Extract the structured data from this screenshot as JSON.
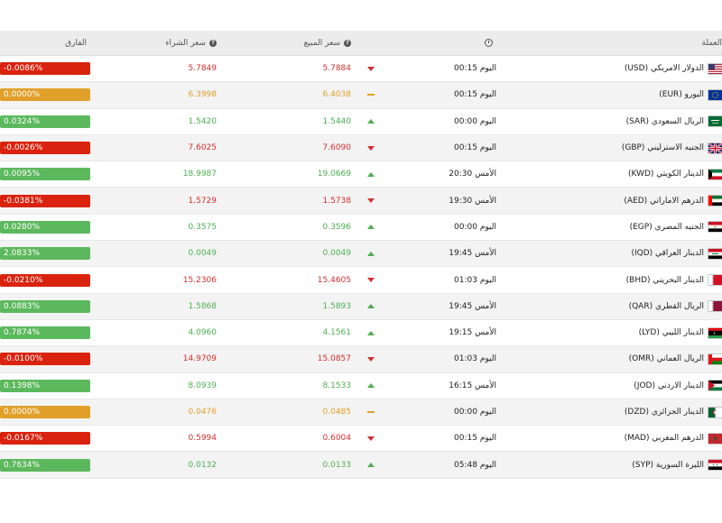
{
  "header": {
    "currency_label": "العملة",
    "sell_label": "سعر المبيع",
    "buy_label": "سعر الشراء",
    "diff_label": "الفارق",
    "time_icon": "clock-icon",
    "info_icon": "info-icon"
  },
  "rows": [
    {
      "name": "الدولار الامريكي (USD)",
      "flag": "us",
      "time": "اليوم 00:15",
      "trend": "down",
      "sell": "5.7884",
      "buy": "5.7849",
      "diff": "-0.0086%"
    },
    {
      "name": "اليورو (EUR)",
      "flag": "eu",
      "time": "اليوم 00:15",
      "trend": "flat",
      "sell": "6.4038",
      "buy": "6.3998",
      "diff": "0.0000%"
    },
    {
      "name": "الريال السعودي (SAR)",
      "flag": "sa",
      "time": "اليوم 00:00",
      "trend": "up",
      "sell": "1.5440",
      "buy": "1.5420",
      "diff": "0.0324%"
    },
    {
      "name": "الجنيه الاسترليني (GBP)",
      "flag": "gb",
      "time": "اليوم 00:15",
      "trend": "down",
      "sell": "7.6090",
      "buy": "7.6025",
      "diff": "-0.0026%"
    },
    {
      "name": "الدينار الكويتي (KWD)",
      "flag": "kw",
      "time": "الأمس 20:30",
      "trend": "up",
      "sell": "19.0669",
      "buy": "18.9987",
      "diff": "0.0095%"
    },
    {
      "name": "الدرهم الاماراتي (AED)",
      "flag": "ae",
      "time": "الأمس 19:30",
      "trend": "down",
      "sell": "1.5738",
      "buy": "1.5729",
      "diff": "-0.0381%"
    },
    {
      "name": "الجنيه المصري (EGP)",
      "flag": "eg",
      "time": "اليوم 00:00",
      "trend": "up",
      "sell": "0.3596",
      "buy": "0.3575",
      "diff": "0.0280%"
    },
    {
      "name": "الدينار العراقي (IQD)",
      "flag": "iq",
      "time": "الأمس 19:45",
      "trend": "up",
      "sell": "0.0049",
      "buy": "0.0049",
      "diff": "2.0833%"
    },
    {
      "name": "الدينار البحريني (BHD)",
      "flag": "bh",
      "time": "اليوم 01:03",
      "trend": "down",
      "sell": "15.4605",
      "buy": "15.2306",
      "diff": "-0.0210%"
    },
    {
      "name": "الريال القطري (QAR)",
      "flag": "qa",
      "time": "الأمس 19:45",
      "trend": "up",
      "sell": "1.5893",
      "buy": "1.5868",
      "diff": "0.0883%"
    },
    {
      "name": "الدينار الليبي (LYD)",
      "flag": "ly",
      "time": "الأمس 19:15",
      "trend": "up",
      "sell": "4.1561",
      "buy": "4.0960",
      "diff": "0.7874%"
    },
    {
      "name": "الريال العماني (OMR)",
      "flag": "om",
      "time": "اليوم 01:03",
      "trend": "down",
      "sell": "15.0857",
      "buy": "14.9709",
      "diff": "-0.0100%"
    },
    {
      "name": "الدينار الاردني (JOD)",
      "flag": "jo",
      "time": "الأمس 16:15",
      "trend": "up",
      "sell": "8.1533",
      "buy": "8.0939",
      "diff": "0.1398%"
    },
    {
      "name": "الدينار الجزائري (DZD)",
      "flag": "dz",
      "time": "اليوم 00:00",
      "trend": "flat",
      "sell": "0.0485",
      "buy": "0.0476",
      "diff": "0.0000%"
    },
    {
      "name": "الدرهم المغربي (MAD)",
      "flag": "ma",
      "time": "اليوم 00:15",
      "trend": "down",
      "sell": "0.6004",
      "buy": "0.5994",
      "diff": "-0.0167%"
    },
    {
      "name": "الليرة السورية (SYP)",
      "flag": "sy",
      "time": "اليوم 05:48",
      "trend": "up",
      "sell": "0.0133",
      "buy": "0.0132",
      "diff": "0.7634%"
    }
  ],
  "colors": {
    "up": "#4caf50",
    "down": "#d32f2f",
    "flat": "#e0a02a"
  }
}
